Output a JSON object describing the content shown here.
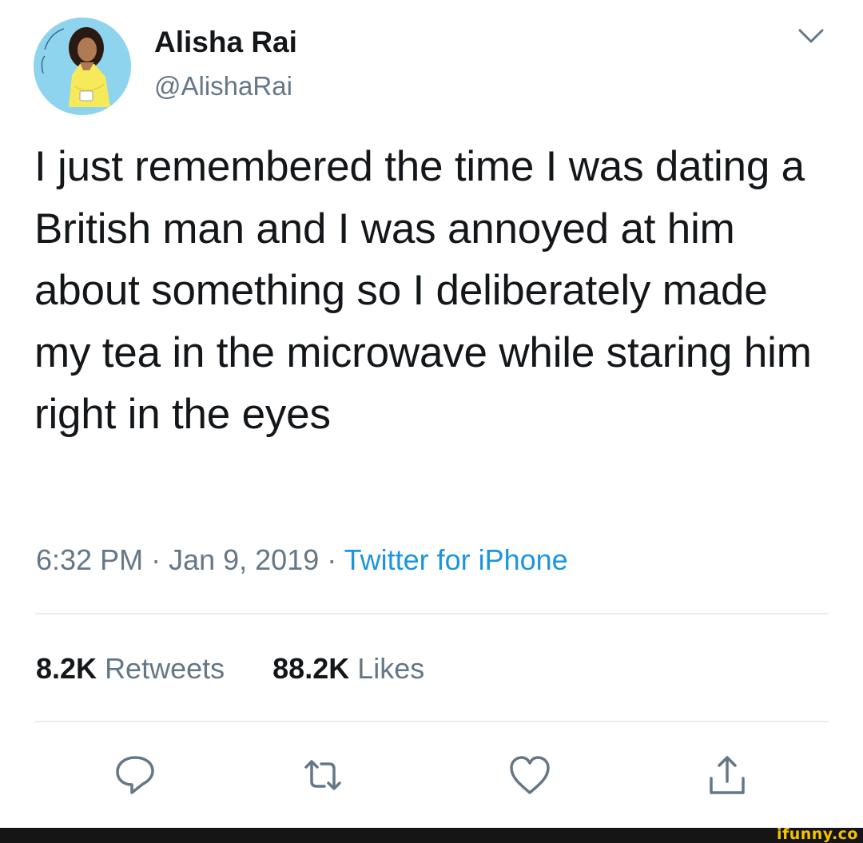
{
  "tweet": {
    "author_name": "Alisha Rai",
    "author_handle": "@AlishaRai",
    "text": "I just remembered the time I was dating a British man and I was annoyed at him about something so I deliberately made my tea in the microwave while staring him right in the eyes",
    "time": "6:32 PM",
    "separator": " · ",
    "date": "Jan 9, 2019",
    "source": "Twitter for iPhone",
    "retweets_count": "8.2K",
    "retweets_label": "Retweets",
    "likes_count": "88.2K",
    "likes_label": "Likes"
  },
  "icons": {
    "caret": "chevron-down-icon",
    "reply": "reply-icon",
    "retweet": "retweet-icon",
    "like": "heart-icon",
    "share": "share-icon"
  },
  "colors": {
    "text": "#14171a",
    "secondary": "#657786",
    "link": "#1b95e0",
    "divider": "#e6ecf0",
    "icon": "#657786",
    "watermark": "#f5c300"
  },
  "watermark": "ifunny.co"
}
